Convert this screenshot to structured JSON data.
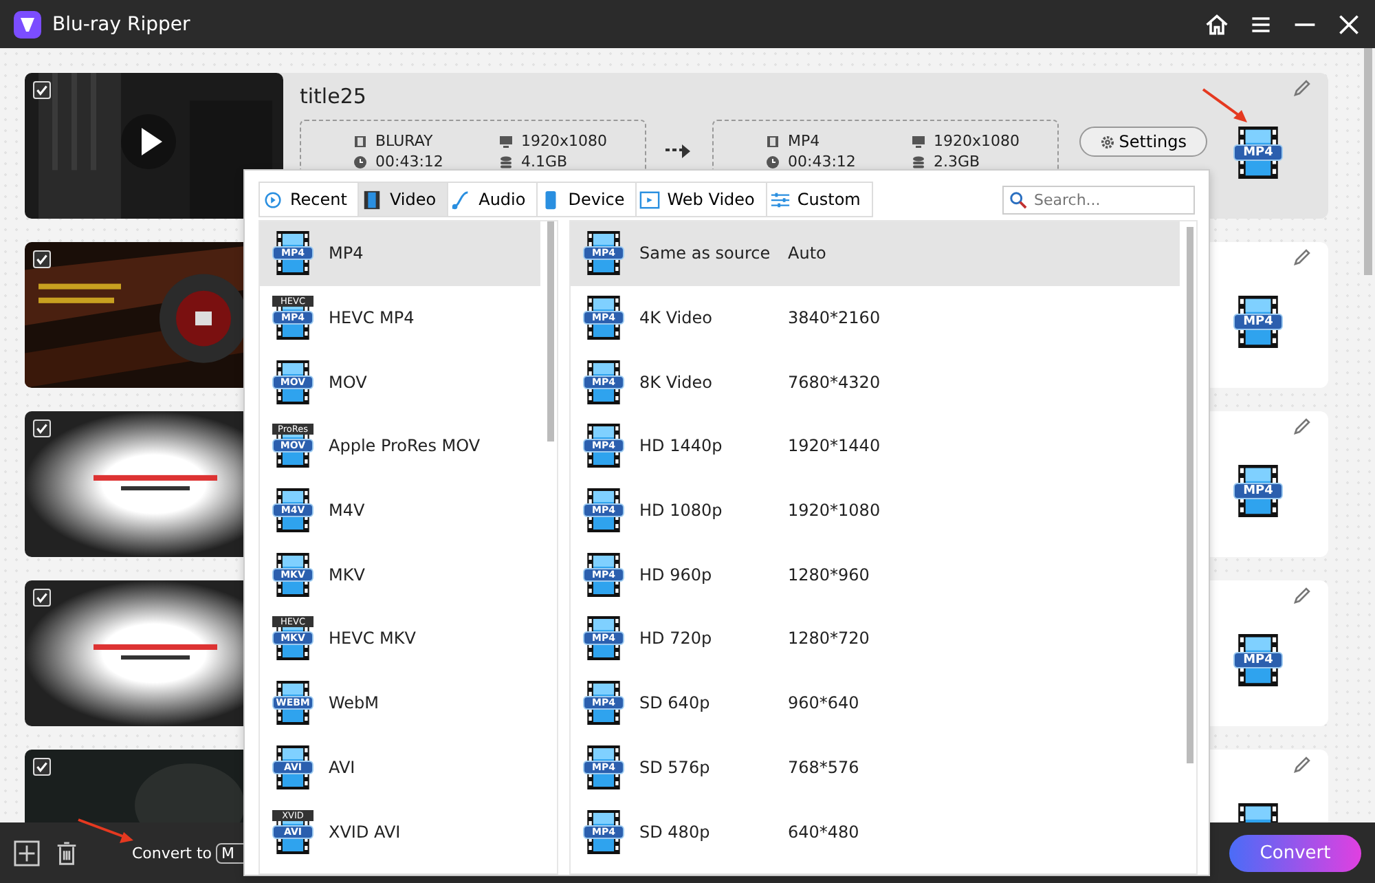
{
  "window": {
    "title": "Blu-ray Ripper"
  },
  "titles": [
    {
      "title": "title25",
      "checked": true,
      "selected": true,
      "source": {
        "format": "BLURAY",
        "resolution": "1920x1080",
        "duration": "00:43:12",
        "size": "4.1GB"
      },
      "output": {
        "format": "MP4",
        "resolution": "1920x1080",
        "duration": "00:43:12",
        "size": "2.3GB"
      },
      "settings_label": "Settings",
      "output_badge": "MP4"
    },
    {
      "checked": true,
      "selected": false,
      "output_badge": "MP4"
    },
    {
      "checked": true,
      "selected": false,
      "output_badge": "MP4"
    },
    {
      "checked": true,
      "selected": false,
      "output_badge": "MP4"
    },
    {
      "checked": true,
      "selected": false
    }
  ],
  "format_menu": {
    "tabs": [
      {
        "label": "Recent",
        "selected": false
      },
      {
        "label": "Video",
        "selected": true
      },
      {
        "label": "Audio",
        "selected": false
      },
      {
        "label": "Device",
        "selected": false
      },
      {
        "label": "Web Video",
        "selected": false
      },
      {
        "label": "Custom",
        "selected": false
      }
    ],
    "search": {
      "placeholder": "Search..."
    },
    "formats": [
      {
        "name": "MP4",
        "badge": "MP4",
        "selected": true
      },
      {
        "name": "HEVC MP4",
        "top_badge": "HEVC",
        "badge": "MP4",
        "selected": false
      },
      {
        "name": "MOV",
        "badge": "MOV",
        "selected": false
      },
      {
        "name": "Apple ProRes MOV",
        "top_badge": "ProRes",
        "badge": "MOV",
        "selected": false
      },
      {
        "name": "M4V",
        "badge": "M4V",
        "selected": false
      },
      {
        "name": "MKV",
        "badge": "MKV",
        "selected": false
      },
      {
        "name": "HEVC MKV",
        "top_badge": "HEVC",
        "badge": "MKV",
        "selected": false
      },
      {
        "name": "WebM",
        "badge": "WEBM",
        "selected": false
      },
      {
        "name": "AVI",
        "badge": "AVI",
        "selected": false
      },
      {
        "name": "XVID AVI",
        "top_badge": "XVID",
        "badge": "AVI",
        "selected": false
      }
    ],
    "presets": [
      {
        "name": "Same as source",
        "resolution": "Auto",
        "badge": "MP4",
        "selected": true
      },
      {
        "name": "4K Video",
        "resolution": "3840*2160",
        "badge": "MP4",
        "selected": false
      },
      {
        "name": "8K Video",
        "resolution": "7680*4320",
        "badge": "MP4",
        "selected": false
      },
      {
        "name": "HD 1440p",
        "resolution": "1920*1440",
        "badge": "MP4",
        "selected": false
      },
      {
        "name": "HD 1080p",
        "resolution": "1920*1080",
        "badge": "MP4",
        "selected": false
      },
      {
        "name": "HD 960p",
        "resolution": "1280*960",
        "badge": "MP4",
        "selected": false
      },
      {
        "name": "HD 720p",
        "resolution": "1280*720",
        "badge": "MP4",
        "selected": false
      },
      {
        "name": "SD 640p",
        "resolution": "960*640",
        "badge": "MP4",
        "selected": false
      },
      {
        "name": "SD 576p",
        "resolution": "768*576",
        "badge": "MP4",
        "selected": false
      },
      {
        "name": "SD 480p",
        "resolution": "640*480",
        "badge": "MP4",
        "selected": false
      }
    ]
  },
  "bottom_bar": {
    "convert_to_label": "Convert to",
    "convert_to_value": "M",
    "convert_button": "Convert"
  }
}
